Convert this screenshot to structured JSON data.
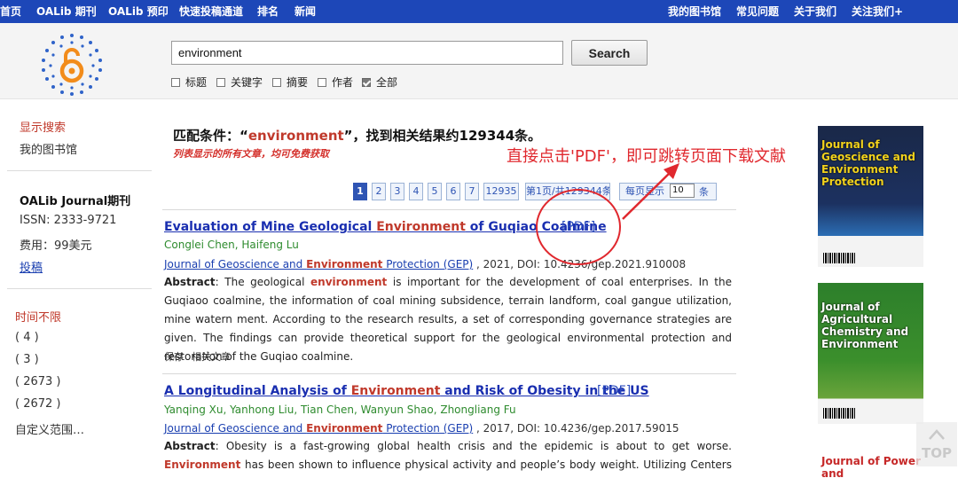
{
  "nav": {
    "left": [
      "首页",
      "OALib 期刊",
      "OALib 预印",
      "快速投稿通道",
      "排名",
      "新闻"
    ],
    "right": [
      "我的图书馆",
      "常见问题",
      "关于我们",
      "关注我们+"
    ]
  },
  "search": {
    "value": "environment",
    "button": "Search",
    "filters": [
      {
        "label": "标题",
        "checked": false
      },
      {
        "label": "关键字",
        "checked": false
      },
      {
        "label": "摘要",
        "checked": false
      },
      {
        "label": "作者",
        "checked": false
      },
      {
        "label": "全部",
        "checked": true
      }
    ]
  },
  "sidebar": {
    "show_search": "显示搜索",
    "my_library": "我的图书馆",
    "journal_title": "OALib Journal期刊",
    "issn": "ISSN: 2333-9721",
    "fee": "费用：99美元",
    "submit": "投稿",
    "time_header": "时间不限",
    "time_items": [
      "( 4 )",
      "( 3 )",
      "( 2673 )",
      "( 2672 )",
      "自定义范围…"
    ]
  },
  "summary": {
    "prefix": "匹配条件：“",
    "keyword": "environment",
    "suffix": "”，找到相关结果约129344条。",
    "note": "列表显示的所有文章，均可免费获取",
    "annotation": "直接点击'PDF'，即可跳转页面下载文献"
  },
  "pagination": {
    "pages": [
      "1",
      "2",
      "3",
      "4",
      "5",
      "6",
      "7",
      "12935"
    ],
    "page_info": "第1页/共129344条",
    "per_page_label": "每页显示",
    "per_page_value": "10",
    "per_page_unit": "条"
  },
  "results": [
    {
      "title_before": "Evaluation of Mine Geological ",
      "title_kw": "Environment",
      "title_after": " of Guqiao Coalmine",
      "pdf": "[PDF]",
      "authors": "Conglei Chen, Haifeng Lu",
      "journal_before": "Journal of Geoscience and ",
      "journal_kw": "Environment",
      "journal_after": " Protection (GEP)",
      "meta": " , 2021, DOI: 10.4236/gep.2021.910008",
      "abstract_label": "Abstract",
      "abstract_1": ": The geological ",
      "abstract_kw": "environment",
      "abstract_2": " is important for the development of coal enterprises. In the Guqiaoo coalmine, the information of coal mining subsidence, terrain landform, coal gangue utilization, mine watern ment. According to the research results, a set of corresponding governance strategies are given. The findings can provide theoretical support for the geological environmental protection and restoration of the Guqiao coalmine.",
      "actions": [
        "保存",
        "相关文章"
      ]
    },
    {
      "title_before": "A Longitudinal Analysis of ",
      "title_kw": "Environment",
      "title_after": " and Risk of Obesity in the US",
      "pdf": "[PDF]",
      "authors": "Yanqing Xu, Yanhong Liu, Tian Chen, Wanyun Shao, Zhongliang Fu",
      "journal_before": "Journal of Geoscience and ",
      "journal_kw": "Environment",
      "journal_after": " Protection (GEP)",
      "meta": " , 2017, DOI: 10.4236/gep.2017.59015",
      "abstract_label": "Abstract",
      "abstract_1": ": Obesity is a fast-growing global health crisis and the epidemic is about to get worse. ",
      "abstract_kw": "Environment",
      "abstract_2": " has been shown to influence physical activity and people’s body weight. Utilizing Centers for Disease Control"
    }
  ],
  "covers": [
    {
      "title": "Journal of Geoscience and Environment Protection",
      "color": "#1c2a44"
    },
    {
      "title": "Journal of Agricultural Chemistry and Environment",
      "color": "#2f7a2a"
    },
    {
      "title": "Journal of Power and",
      "color": "#c62828"
    }
  ],
  "to_top": "TOP"
}
